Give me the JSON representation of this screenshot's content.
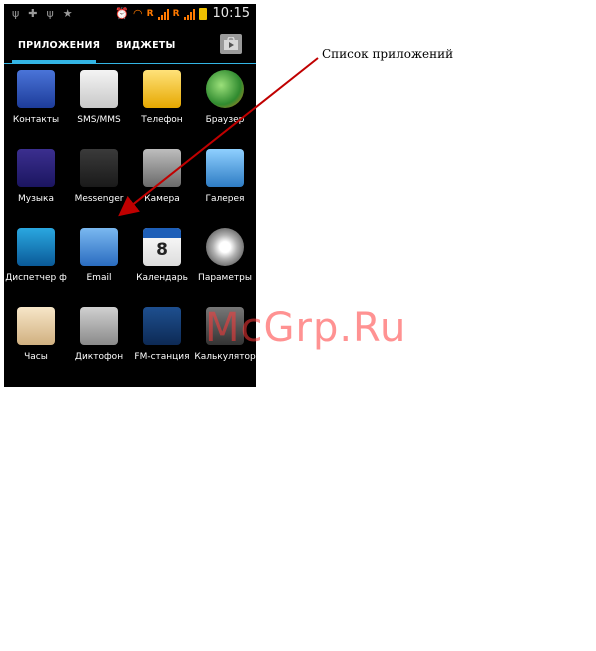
{
  "status_bar": {
    "network_label": "R",
    "network_label_2": "R",
    "time": "10:15"
  },
  "tabs": {
    "apps": "ПРИЛОЖЕНИЯ",
    "widgets": "ВИДЖЕТЫ"
  },
  "apps": [
    {
      "label": "Контакты",
      "icon": "contacts-icon"
    },
    {
      "label": "SMS/MMS",
      "icon": "sms-icon"
    },
    {
      "label": "Телефон",
      "icon": "phone-icon"
    },
    {
      "label": "Браузер",
      "icon": "browser-icon"
    },
    {
      "label": "Музыка",
      "icon": "music-icon"
    },
    {
      "label": "Messenger",
      "icon": "messenger-icon"
    },
    {
      "label": "Камера",
      "icon": "camera-icon"
    },
    {
      "label": "Галерея",
      "icon": "gallery-icon"
    },
    {
      "label": "Диспетчер ф",
      "icon": "file-manager-icon"
    },
    {
      "label": "Email",
      "icon": "email-icon"
    },
    {
      "label": "Календарь",
      "icon": "calendar-icon"
    },
    {
      "label": "Параметры",
      "icon": "settings-icon"
    },
    {
      "label": "Часы",
      "icon": "clock-icon"
    },
    {
      "label": "Диктофон",
      "icon": "recorder-icon"
    },
    {
      "label": "FM-станция",
      "icon": "fm-radio-icon"
    },
    {
      "label": "Калькулятор",
      "icon": "calculator-icon"
    }
  ],
  "calendar_day": "8",
  "annotation": "Список приложений",
  "watermark": "McGrp.Ru",
  "colors": {
    "accent": "#33b5e5",
    "signal": "#ff7a00",
    "arrow": "#c00000",
    "watermark": "#ff3a3a"
  }
}
